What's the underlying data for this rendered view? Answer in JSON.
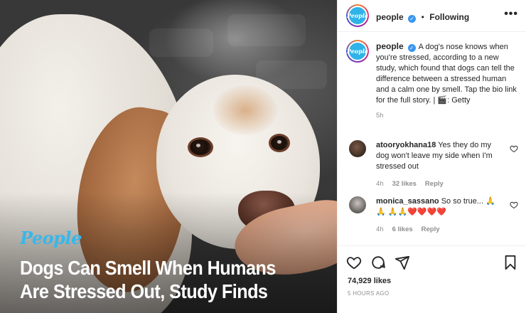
{
  "post_image": {
    "brand": "People",
    "headline_lines": [
      "Dogs Can Smell When Humans",
      "Are Stressed Out, Study Finds"
    ]
  },
  "header": {
    "avatar_label": "People",
    "username": "people",
    "separator": "•",
    "follow_state": "Following",
    "more_icon": "more-horizontal-icon"
  },
  "caption": {
    "username": "people",
    "text": "A dog's nose knows when you're stressed, according to a new study, which found that dogs can tell the difference between a stressed human and a calm one by smell. Tap the bio link for the full story. | 🎬: Getty",
    "time": "5h"
  },
  "comments": [
    {
      "username": "atooryokhana18",
      "text": "Yes they do my dog won't leave my side when I'm stressed out",
      "time": "4h",
      "likes": "32 likes",
      "reply": "Reply"
    },
    {
      "username": "monica_sassano",
      "text": "So so true... 🙏🙏 🙏🙏❤️❤️❤️❤️",
      "time": "4h",
      "likes": "6 likes",
      "reply": "Reply"
    }
  ],
  "footer": {
    "likes": "74,929 likes",
    "time_ago": "5 HOURS AGO",
    "icons": [
      "heart-icon",
      "comment-icon",
      "share-icon",
      "bookmark-icon"
    ]
  },
  "colors": {
    "brand_blue": "#38b7ea",
    "verified_blue": "#3897f0",
    "muted_text": "#8e8e8e",
    "border": "#efefef"
  }
}
